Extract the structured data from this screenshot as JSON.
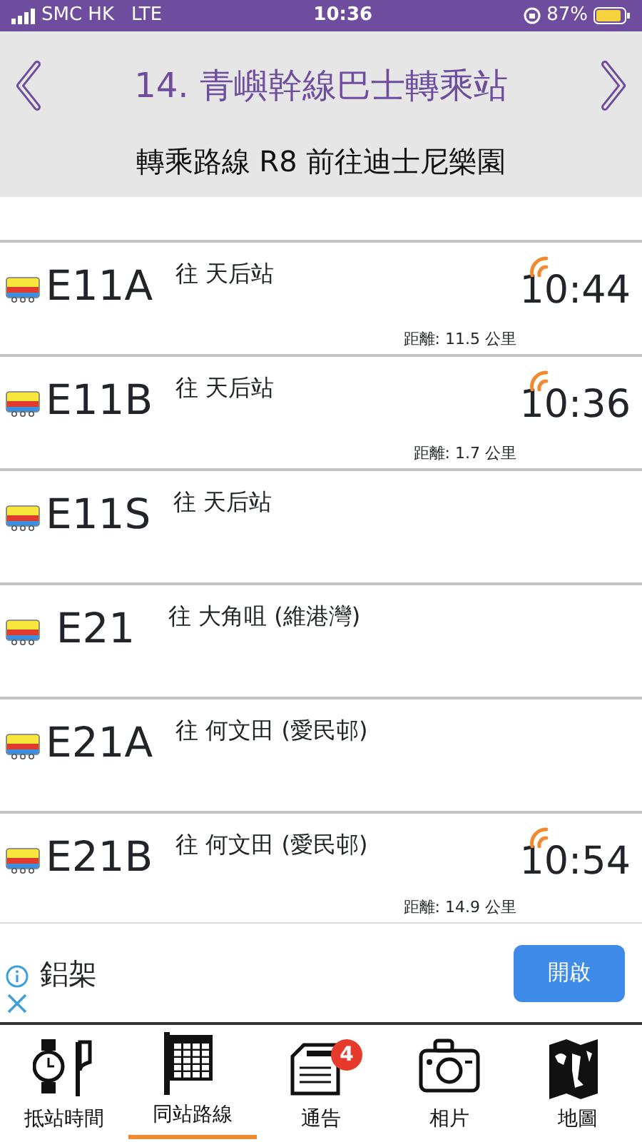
{
  "status_bar": {
    "carrier": "SMC HK",
    "network": "LTE",
    "time": "10:36",
    "battery": "87%"
  },
  "header": {
    "title": "14. 青嶼幹線巴士轉乘站",
    "subtitle": "轉乘路線 R8 前往迪士尼樂園"
  },
  "routes": [
    {
      "route": "E11A",
      "prefix": "往",
      "destination": "天后站",
      "live": true,
      "eta": "10:44",
      "distance": "距離: 11.5 公里"
    },
    {
      "route": "E11B",
      "prefix": "往",
      "destination": "天后站",
      "live": true,
      "eta": "10:36",
      "distance": "距離: 1.7 公里"
    },
    {
      "route": "E11S",
      "prefix": "往",
      "destination": "天后站",
      "live": false
    },
    {
      "route": "E21",
      "prefix": "往",
      "destination": "大角咀 (維港灣)",
      "live": false
    },
    {
      "route": "E21A",
      "prefix": "往",
      "destination": "何文田 (愛民邨)",
      "live": false
    },
    {
      "route": "E21B",
      "prefix": "往",
      "destination": "何文田 (愛民邨)",
      "live": true,
      "eta": "10:54",
      "distance": "距離: 14.9 公里"
    }
  ],
  "ad": {
    "text": "鋁架",
    "button": "開啟"
  },
  "tabs": [
    {
      "kind": "clock",
      "label": "抵站時間",
      "selected": false
    },
    {
      "kind": "grid",
      "label": "同站路線",
      "selected": true
    },
    {
      "kind": "notice",
      "label": "通告",
      "selected": false,
      "badge": "4"
    },
    {
      "kind": "camera",
      "label": "相片",
      "selected": false
    },
    {
      "kind": "map",
      "label": "地圖",
      "selected": false
    }
  ]
}
